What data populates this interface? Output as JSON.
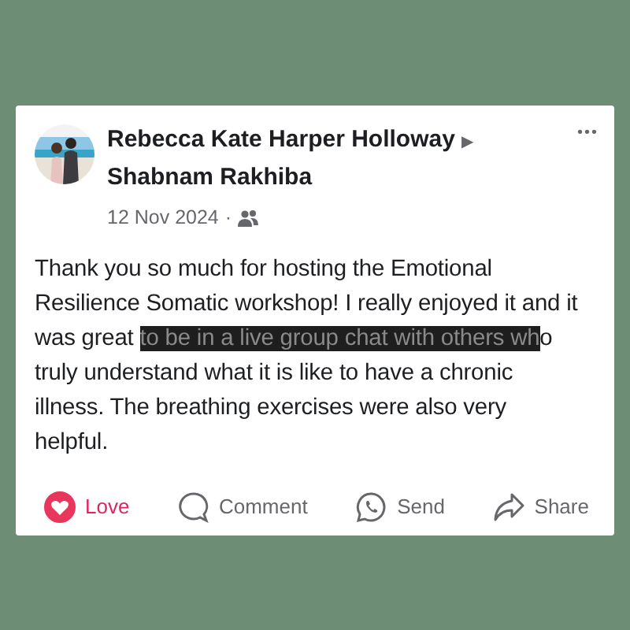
{
  "post": {
    "author": "Rebecca Kate Harper Holloway",
    "arrow": "▶",
    "recipient": "Shabnam Rakhiba",
    "date": "12 Nov 2024",
    "separator": "·",
    "more": "•••",
    "body": [
      {
        "text": "Thank you so much for hosting the Emotional Resilience Somatic workshop! I really enjoyed it and it was great ",
        "redacted": false
      },
      {
        "text": "to be in a live group chat with others wh",
        "redacted": true
      },
      {
        "text": "o truly understand what it is like to have a chronic illness. The breathing exercises were also very helpful.",
        "redacted": false
      }
    ]
  },
  "actions": [
    {
      "kind": "love",
      "label": "Love",
      "selected": true
    },
    {
      "kind": "comment",
      "label": "Comment",
      "selected": false
    },
    {
      "kind": "send",
      "label": "Send",
      "selected": false
    },
    {
      "kind": "share",
      "label": "Share",
      "selected": false
    }
  ]
}
